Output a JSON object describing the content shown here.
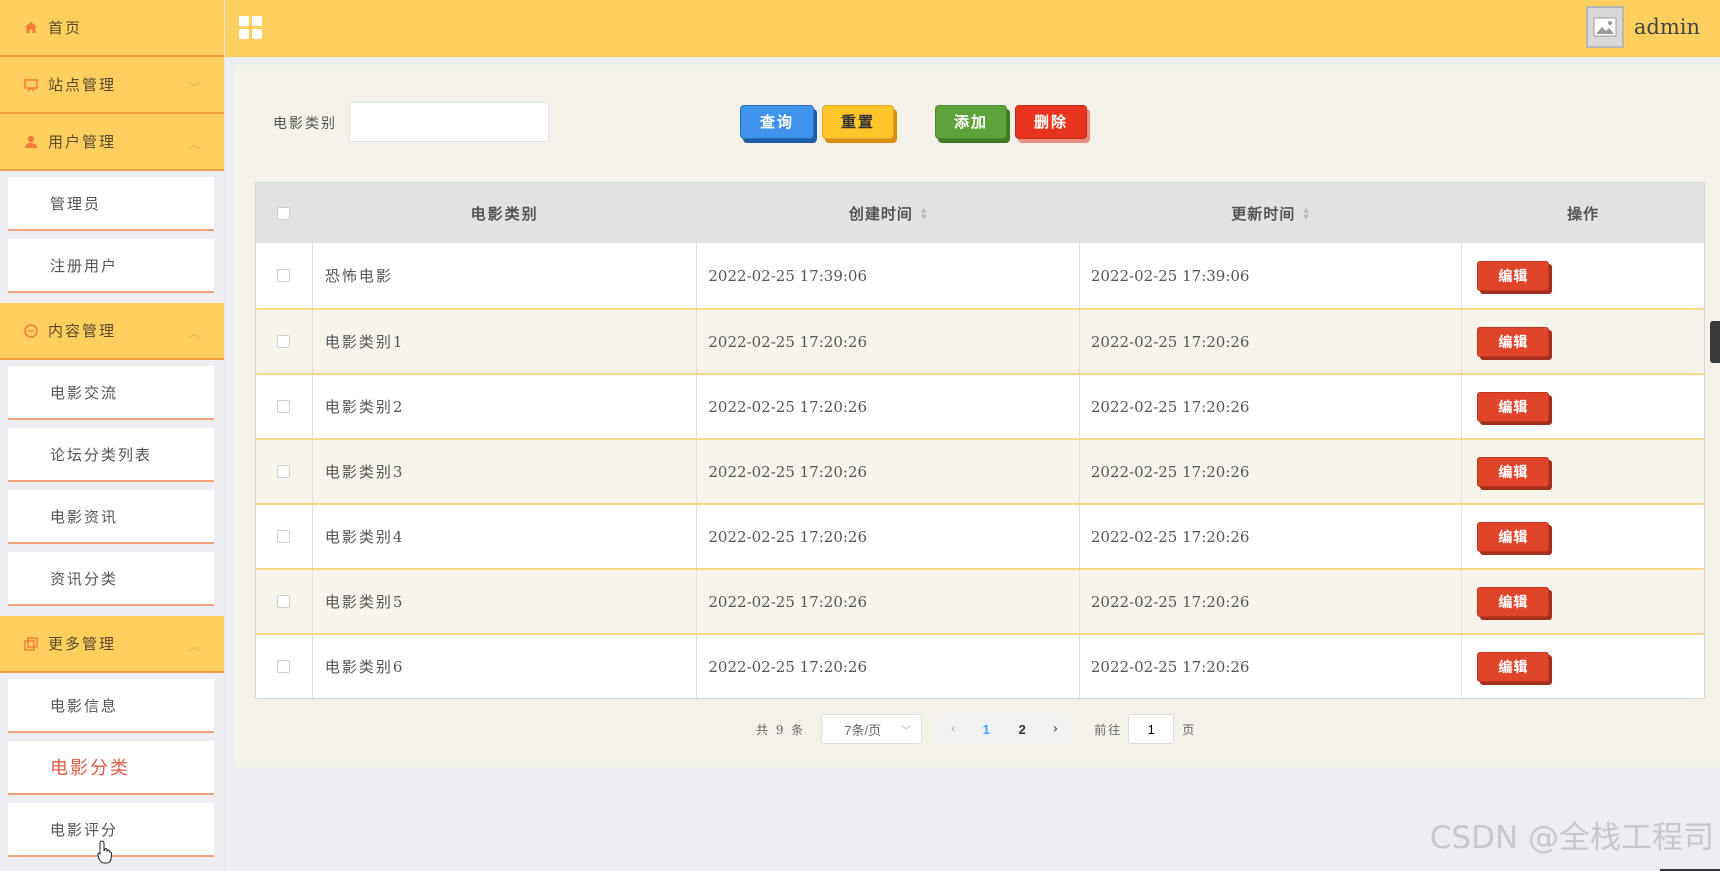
{
  "sidebar": {
    "home_label": "首页",
    "groups": [
      {
        "label": "站点管理",
        "items": []
      },
      {
        "label": "用户管理",
        "items": [
          "管理员",
          "注册用户"
        ]
      },
      {
        "label": "内容管理",
        "items": [
          "电影交流",
          "论坛分类列表",
          "电影资讯",
          "资讯分类"
        ]
      },
      {
        "label": "更多管理",
        "items": [
          "电影信息",
          "电影分类",
          "电影评分"
        ]
      }
    ]
  },
  "header": {
    "user_name": "admin"
  },
  "search": {
    "label": "电影类别",
    "value": "",
    "query_label": "查询",
    "reset_label": "重置",
    "add_label": "添加",
    "delete_label": "删除"
  },
  "table": {
    "columns": [
      "电影类别",
      "创建时间",
      "更新时间",
      "操作"
    ],
    "edit_label": "编辑",
    "rows": [
      {
        "category": "恐怖电影",
        "created": "2022-02-25 17:39:06",
        "updated": "2022-02-25 17:39:06"
      },
      {
        "category": "电影类别1",
        "created": "2022-02-25 17:20:26",
        "updated": "2022-02-25 17:20:26"
      },
      {
        "category": "电影类别2",
        "created": "2022-02-25 17:20:26",
        "updated": "2022-02-25 17:20:26"
      },
      {
        "category": "电影类别3",
        "created": "2022-02-25 17:20:26",
        "updated": "2022-02-25 17:20:26"
      },
      {
        "category": "电影类别4",
        "created": "2022-02-25 17:20:26",
        "updated": "2022-02-25 17:20:26"
      },
      {
        "category": "电影类别5",
        "created": "2022-02-25 17:20:26",
        "updated": "2022-02-25 17:20:26"
      },
      {
        "category": "电影类别6",
        "created": "2022-02-25 17:20:26",
        "updated": "2022-02-25 17:20:26"
      }
    ]
  },
  "pagination": {
    "total_text": "共 9 条",
    "page_size": "7条/页",
    "pages": [
      "1",
      "2"
    ],
    "current_page": "1",
    "goto_label": "前往",
    "jump_value": "1",
    "page_unit": "页"
  },
  "watermark": "CSDN @全栈工程司",
  "colors": {
    "header_bg": "#ffd060",
    "active_menu": "#e25b45",
    "query_btn": "#3f93ea",
    "reset_btn": "#ffc629",
    "add_btn": "#5ea23a",
    "delete_btn": "#e8341e",
    "edit_btn": "#e0452a"
  }
}
